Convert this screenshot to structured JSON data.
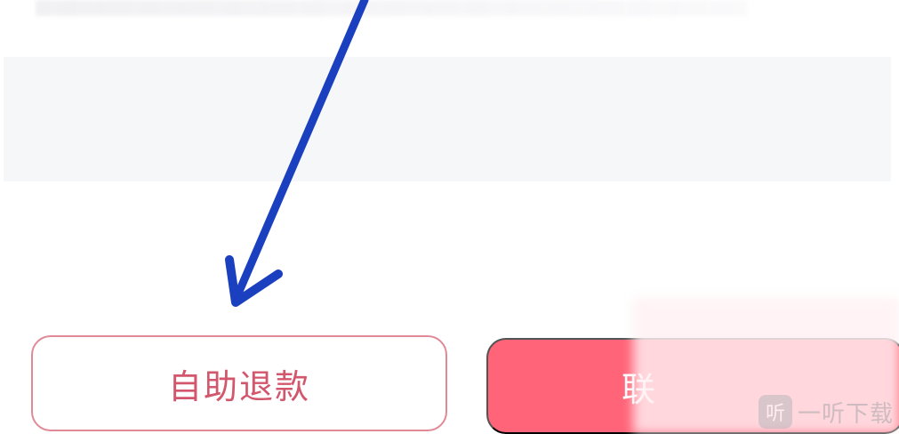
{
  "buttons": {
    "self_refund_label": "自助退款",
    "primary_label_partial": "联"
  },
  "watermark": {
    "logo_glyph": "听",
    "text": "一听下载"
  },
  "colors": {
    "outline_border": "#e08a98",
    "outline_text": "#d2566c",
    "primary_fill": "#ff6478",
    "arrow": "#1a3fbf",
    "panel": "#f6f7f9"
  }
}
